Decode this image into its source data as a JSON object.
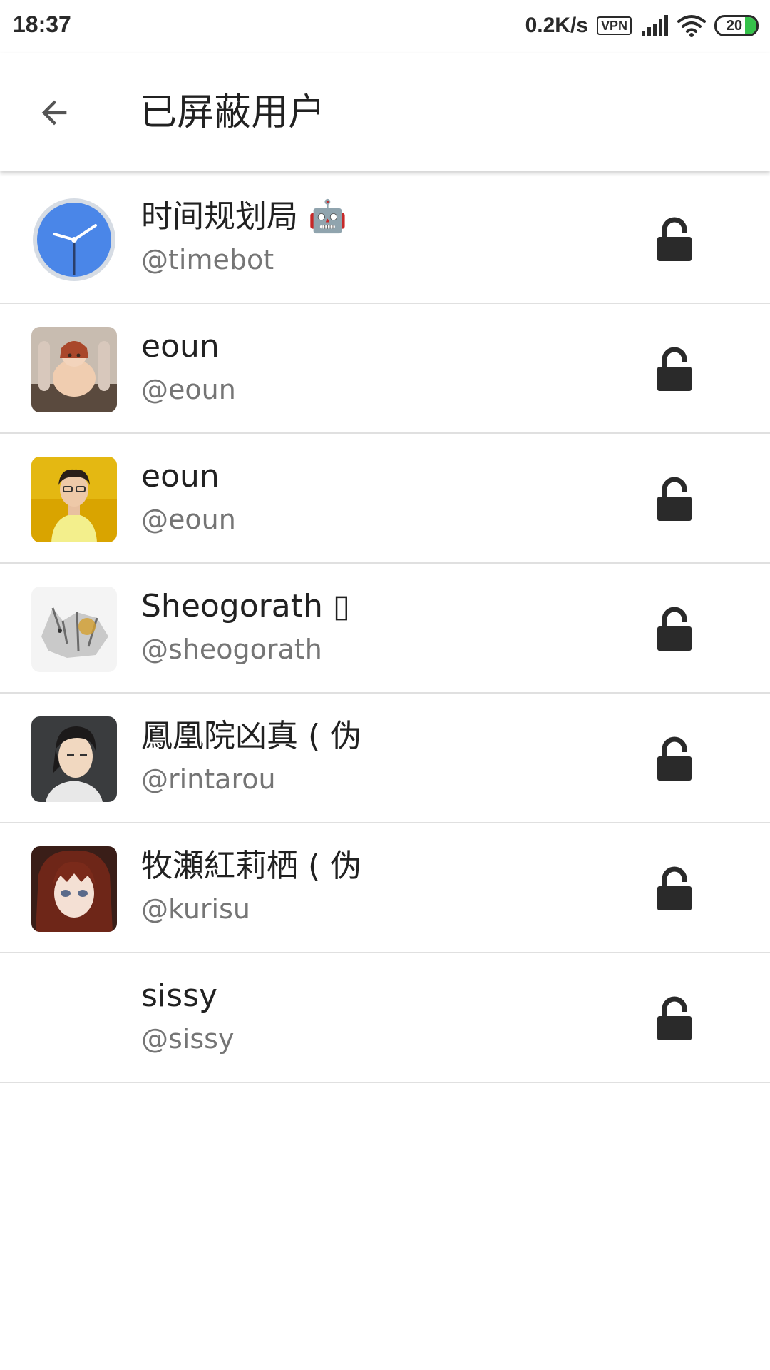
{
  "status_bar": {
    "time": "18:37",
    "net_speed": "0.2K/s",
    "vpn": "VPN",
    "battery": "20"
  },
  "app_bar": {
    "title": "已屏蔽用户",
    "back_icon": "arrow-back-icon"
  },
  "users": [
    {
      "name": "时间规划局 🤖",
      "handle": "@timebot",
      "avatar": "clock-avatar",
      "action_icon": "lock-open-icon"
    },
    {
      "name": "eoun",
      "handle": "@eoun",
      "avatar": "anime-girl-avatar",
      "action_icon": "lock-open-icon"
    },
    {
      "name": "eoun",
      "handle": "@eoun",
      "avatar": "photo-woman-avatar",
      "action_icon": "lock-open-icon"
    },
    {
      "name": "Sheogorath ▯",
      "handle": "@sheogorath",
      "avatar": "wolf-sketch-avatar",
      "action_icon": "lock-open-icon"
    },
    {
      "name": "鳳凰院凶真 ( 伪",
      "handle": "@rintarou",
      "avatar": "anime-man-avatar",
      "action_icon": "lock-open-icon"
    },
    {
      "name": "牧瀬紅莉栖 ( 伪",
      "handle": "@kurisu",
      "avatar": "anime-redhair-avatar",
      "action_icon": "lock-open-icon"
    },
    {
      "name": "sissy",
      "handle": "@sissy",
      "avatar": "",
      "action_icon": "lock-open-icon"
    }
  ],
  "colors": {
    "divider": "#e0e0e0",
    "handle": "#757575",
    "clock_blue": "#4a86e8",
    "battery_green": "#35c24a"
  }
}
